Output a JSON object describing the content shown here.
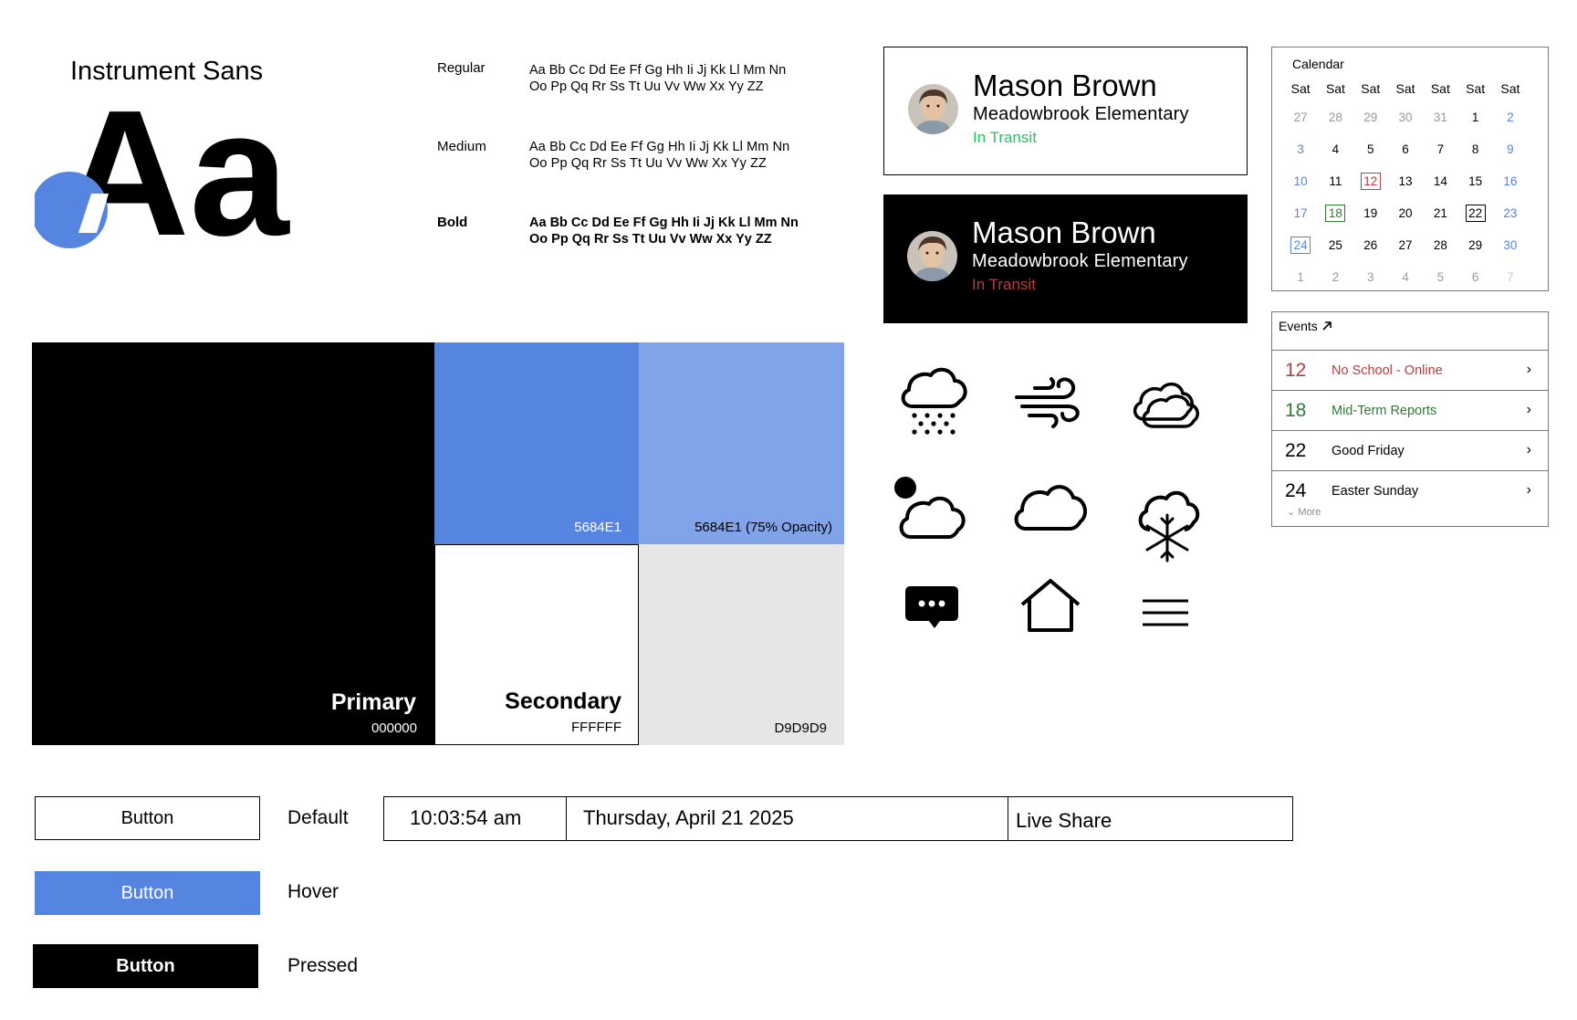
{
  "typography": {
    "font_name": "Instrument Sans",
    "specimen_glyphs": "Aa",
    "weights": [
      {
        "label": "Regular",
        "line1": "Aa Bb Cc Dd Ee Ff Gg Hh Ii Jj Kk Ll Mm Nn",
        "line2": "Oo Pp Qq Rr Ss Tt Uu Vv Ww Xx Yy ZZ"
      },
      {
        "label": "Medium",
        "line1": "Aa Bb Cc Dd Ee Ff Gg Hh Ii Jj Kk Ll Mm Nn",
        "line2": "Oo Pp Qq Rr Ss Tt Uu Vv Ww Xx Yy ZZ"
      },
      {
        "label": "Bold",
        "line1": "Aa Bb Cc Dd Ee Ff Gg Hh Ii Jj Kk Ll Mm Nn",
        "line2": "Oo Pp Qq Rr Ss Tt Uu Vv Ww Xx Yy ZZ"
      }
    ]
  },
  "colors": {
    "primary": {
      "name": "Primary",
      "code": "000000",
      "hex": "#000000"
    },
    "secondary": {
      "name": "Secondary",
      "code": "FFFFFF",
      "hex": "#FFFFFF"
    },
    "accent": {
      "code": "5684E1",
      "hex": "#5684E1"
    },
    "accent_75": {
      "code": "5684E1 (75% Opacity)"
    },
    "gray": {
      "code": "D9D9D9",
      "hex": "#D9D9D9"
    },
    "status_light": "#22C55E",
    "status_dark": "#B0413E"
  },
  "profile": {
    "name": "Mason Brown",
    "school": "Meadowbrook Elementary",
    "status": "In Transit"
  },
  "calendar": {
    "title": "Calendar",
    "day_names": [
      "Sat",
      "Sat",
      "Sat",
      "Sat",
      "Sat",
      "Sat",
      "Sat"
    ],
    "weeks": [
      [
        "27",
        "28",
        "29",
        "30",
        "31",
        "1",
        "2"
      ],
      [
        "3",
        "4",
        "5",
        "6",
        "7",
        "8",
        "9"
      ],
      [
        "10",
        "11",
        "12",
        "13",
        "14",
        "15",
        "16"
      ],
      [
        "17",
        "18",
        "19",
        "20",
        "21",
        "22",
        "23"
      ],
      [
        "24",
        "25",
        "26",
        "27",
        "28",
        "29",
        "30"
      ],
      [
        "1",
        "2",
        "3",
        "4",
        "5",
        "6",
        "7"
      ]
    ]
  },
  "events": {
    "title": "Events",
    "items": [
      {
        "day": "12",
        "title": "No School - Online"
      },
      {
        "day": "18",
        "title": "Mid-Term Reports"
      },
      {
        "day": "22",
        "title": "Good Friday"
      },
      {
        "day": "24",
        "title": "Easter Sunday"
      }
    ],
    "more_label": "More"
  },
  "icons": [
    "snow-cloud-icon",
    "wind-icon",
    "cloudy-icon",
    "partly-cloudy-night-icon",
    "cloud-icon",
    "snowflake-cloud-icon",
    "chat-bubble-icon",
    "home-icon",
    "menu-icon"
  ],
  "buttons": {
    "label": "Button",
    "states": [
      "Default",
      "Hover",
      "Pressed"
    ]
  },
  "status_bar": {
    "time": "10:03:54 am",
    "date": "Thursday, April 21 2025",
    "live_share": "Live Share"
  }
}
